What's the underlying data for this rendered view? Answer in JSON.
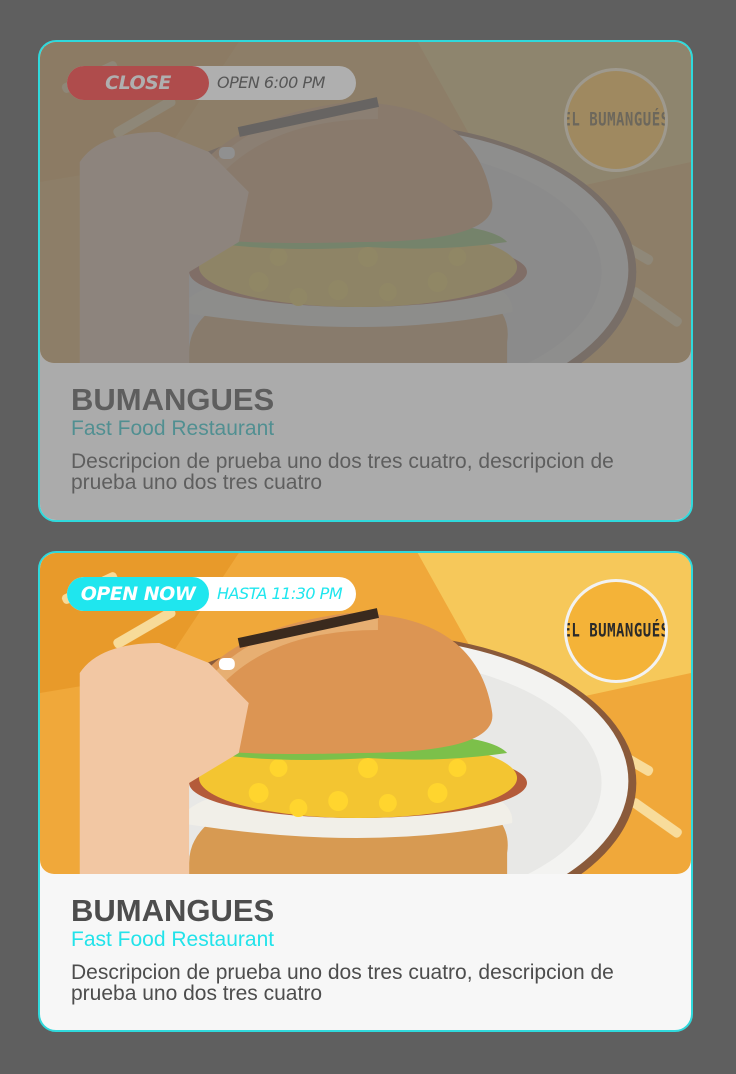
{
  "restaurants": [
    {
      "status": "CLOSE",
      "hours": "OPEN 6:00 PM",
      "logo_text": "EL BUMANGUÉS",
      "name": "BUMANGUES",
      "category": "Fast Food Restaurant",
      "description": "Descripcion de prueba uno dos tres cuatro, descripcion de prueba uno dos tres cuatro",
      "state": "closed",
      "status_color": "#ff2424"
    },
    {
      "status": "OPEN NOW",
      "hours": "HASTA 11:30 PM",
      "logo_text": "EL BUMANGUÉS",
      "name": "BUMANGUES",
      "category": "Fast Food Restaurant",
      "description": "Descripcion de prueba uno dos tres cuatro, descripcion de prueba uno dos tres cuatro",
      "state": "open",
      "status_color": "#1fe6ee"
    }
  ],
  "colors": {
    "background": "#5f5f5f",
    "accent": "#22e3ea",
    "card": "#f7f7f7",
    "logo": "#f4b338"
  }
}
